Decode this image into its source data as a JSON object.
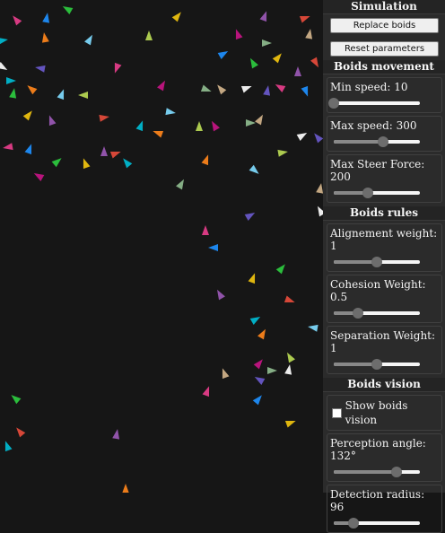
{
  "panel": {
    "simulation": {
      "header": "Simulation",
      "replace_label": "Replace boids",
      "reset_label": "Reset parameters"
    },
    "movement": {
      "header": "Boids movement",
      "min_speed": {
        "label": "Min speed: 10",
        "fraction": 0.0
      },
      "max_speed": {
        "label": "Max speed: 300",
        "fraction": 0.57
      },
      "max_steer": {
        "label": "Max Steer Force: 200",
        "fraction": 0.4
      }
    },
    "rules": {
      "header": "Boids rules",
      "alignment": {
        "label": "Alignement weight: 1",
        "fraction": 0.5
      },
      "cohesion": {
        "label": "Cohesion Weight: 0.5",
        "fraction": 0.28
      },
      "separation": {
        "label": "Separation Weight: 1",
        "fraction": 0.5
      }
    },
    "vision": {
      "header": "Boids vision",
      "show_vision": {
        "label": "Show boids vision",
        "checked": false
      },
      "perception": {
        "label": "Perception angle: 132°",
        "fraction": 0.73
      },
      "radius": {
        "label": "Detection radius: 96",
        "fraction": 0.23
      }
    }
  },
  "colors": {
    "canvas_background": "#161616",
    "panel_background": "#2b2b2b",
    "boid_palette": [
      "#e83e8c",
      "#1e90ff",
      "#2ecc40",
      "#f1c40f",
      "#9b59b6",
      "#e74c3c",
      "#00bcd4",
      "#ff851b",
      "#7fdbff",
      "#bada55",
      "#c71585",
      "#8fbc8f",
      "#d2b48c",
      "#ffffff",
      "#6a5acd"
    ]
  }
}
